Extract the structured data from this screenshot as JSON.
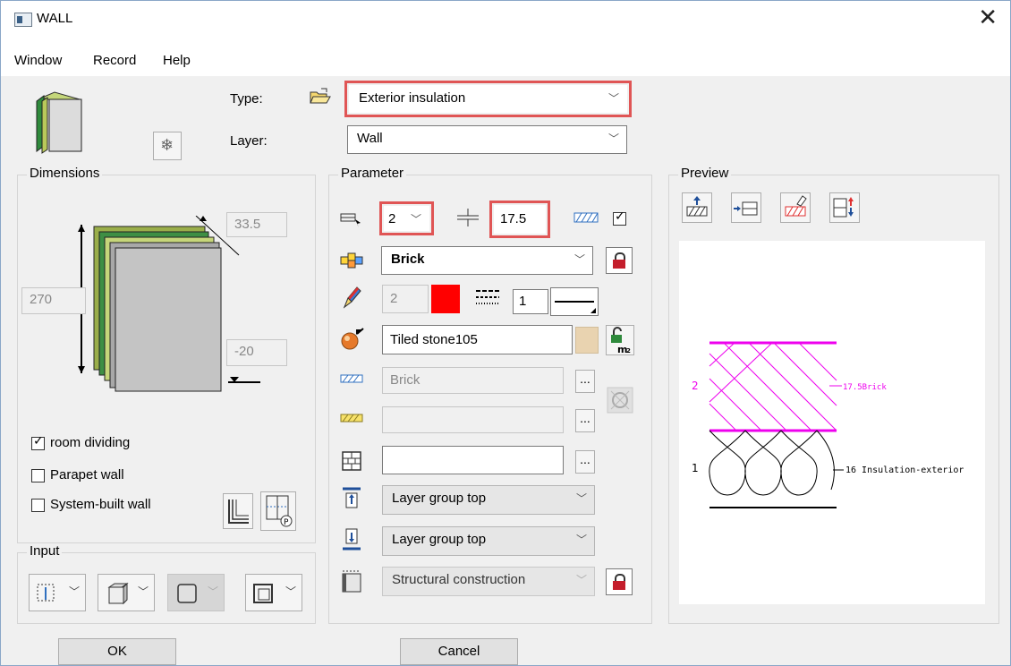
{
  "window": {
    "title": "WALL",
    "close_glyph": "✕"
  },
  "menu": [
    "Window",
    "Record",
    "Help"
  ],
  "top": {
    "type_label": "Type:",
    "type_value": "Exterior insulation",
    "layer_label": "Layer:",
    "layer_value": "Wall"
  },
  "dimensions": {
    "label": "Dimensions",
    "thickness": "33.5",
    "height": "270",
    "offset": "-20",
    "room_dividing_label": "room dividing",
    "room_dividing_checked": true,
    "parapet_label": "Parapet wall",
    "parapet_checked": false,
    "system_built_label": "System-built wall",
    "system_built_checked": false
  },
  "input": {
    "label": "Input"
  },
  "parameter": {
    "label": "Parameter",
    "layer_number": "2",
    "layer_thickness": "17.5",
    "hatch_checked": true,
    "material": "Brick",
    "pen": "2",
    "line_number": "1",
    "pen_color": "#ff0000",
    "surface": "Tiled stone105",
    "hatch_name": "Brick",
    "pattern_name": "",
    "fill_name": "",
    "group_top_1": "Layer group top",
    "group_top_2": "Layer group top",
    "construction": "Structural construction"
  },
  "preview": {
    "label": "Preview",
    "layer2_num": "2",
    "layer2_text": "17.5Brick",
    "layer1_num": "1",
    "layer1_text": "16 Insulation-exterior",
    "layer2_color": "#ee00ee"
  },
  "buttons": {
    "ok": "OK",
    "cancel": "Cancel"
  }
}
